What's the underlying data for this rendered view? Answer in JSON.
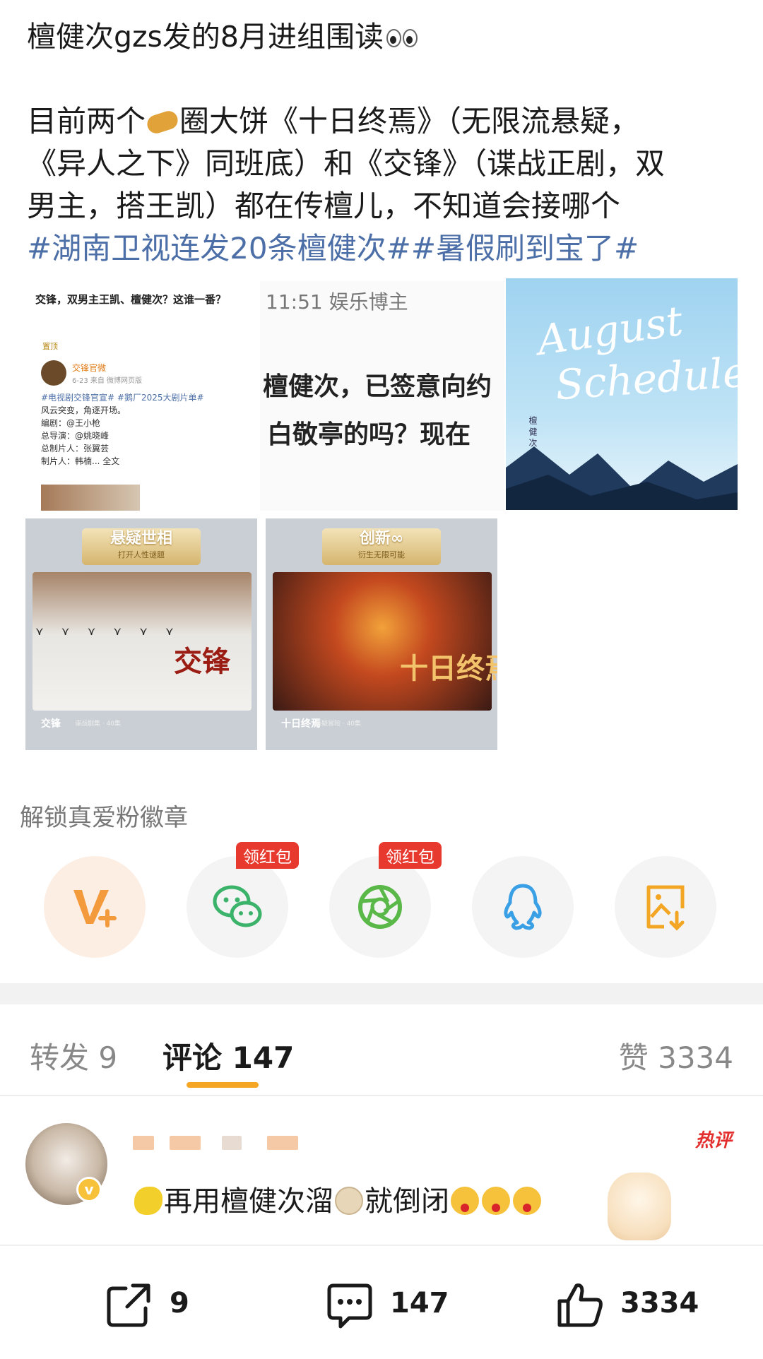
{
  "post": {
    "title": "檀健次gzs发的8月进组围读",
    "line1_a": "目前两个",
    "line1_b": "圈大饼《十日终焉》（无限流悬疑，",
    "line2": "《异人之下》同班底）和《交锋》（谍战正剧，双",
    "line3": "男主，搭王凯）都在传檀儿，不知道会接哪个",
    "topics": "#湖南卫视连发20条檀健次##暑假刷到宝了#"
  },
  "images": {
    "img1": {
      "headline": "交锋，双男主王凯、檀健次？这谁一番？",
      "pinned": "置顶",
      "account": "交锋官微",
      "meta": "6-23 来自 微博网页版",
      "tags": "#电视剧交锋官宣# #鹅厂2025大剧片单#",
      "l1": "风云突变，角逐开场。",
      "l2": "编剧：@王小枪",
      "l3": "总导演：@姚晓峰",
      "l4": "总制片人：张翼芸",
      "l5": "制片人：韩楠... 全文"
    },
    "img2": {
      "header": "11:51 娱乐博主",
      "l1": "檀健次，已签意向约",
      "l2": "白敬亭的吗？现在"
    },
    "img3": {
      "line1": "August",
      "line2": "Schedule",
      "credit": "檀 健 次"
    },
    "img4": {
      "badge": "悬疑世相",
      "badge_sub": "打开人性谜题",
      "title": "交锋",
      "caption": "交锋",
      "caption_sub": "谍战剧集 · 40集"
    },
    "img5": {
      "badge": "创新∞",
      "badge_sub": "衍生无限可能",
      "title": "十日终焉",
      "caption": "十日终焉",
      "caption_sub": "悬疑冒险 · 40集"
    }
  },
  "share": {
    "unlock_label": "解锁真爱粉徽章",
    "red_packet": "领红包",
    "items": [
      "vip-icon",
      "wechat-icon",
      "moments-icon",
      "qq-icon",
      "save-image-icon"
    ]
  },
  "tabs": {
    "forward": "转发 9",
    "comment": "评论 147",
    "like": "赞 3334"
  },
  "comment": {
    "hot_tag": "热评",
    "text_a": "再用檀健次溜",
    "text_b": "就倒闭"
  },
  "bottom": {
    "share_count": "9",
    "comment_count": "147",
    "like_count": "3334"
  },
  "colors": {
    "topic": "#4d6fa8",
    "accent": "#f5a623",
    "red_packet": "#e8392f",
    "hot": "#e3302e"
  }
}
